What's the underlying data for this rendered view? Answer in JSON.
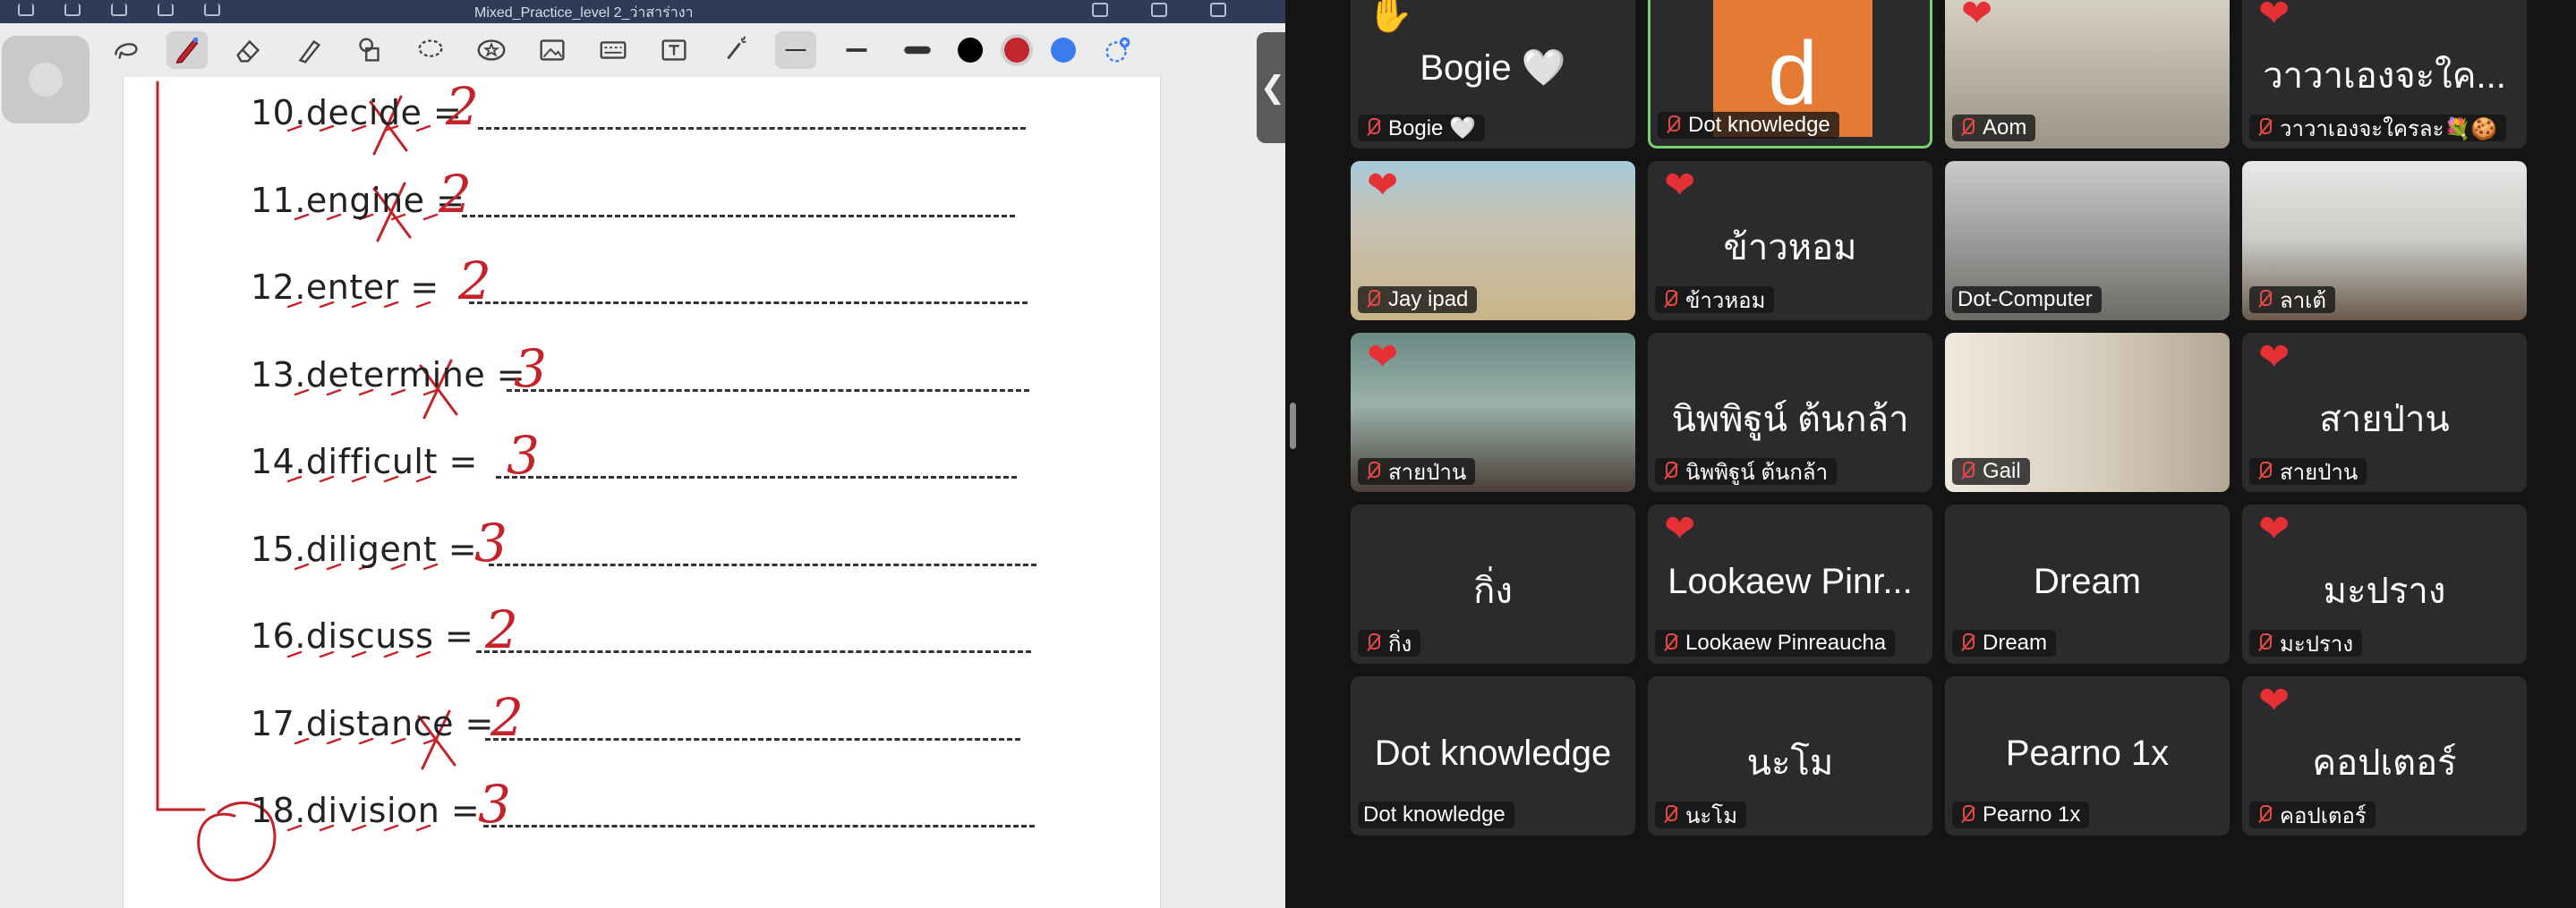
{
  "note_app": {
    "document_title": "Mixed_Practice_level 2_ว่าสาร่างา",
    "collapse_glyph": "❮",
    "tools": [
      {
        "name": "lasso-icon",
        "selected": false
      },
      {
        "name": "pen-icon",
        "selected": true
      },
      {
        "name": "eraser-icon",
        "selected": false
      },
      {
        "name": "highlighter-icon",
        "selected": false
      },
      {
        "name": "shapes-icon",
        "selected": false
      },
      {
        "name": "lasso-select-icon",
        "selected": false
      },
      {
        "name": "sticker-icon",
        "selected": false
      },
      {
        "name": "image-icon",
        "selected": false
      },
      {
        "name": "keyboard-icon",
        "selected": false
      },
      {
        "name": "text-box-icon",
        "selected": false
      },
      {
        "name": "laser-pointer-icon",
        "selected": false
      },
      {
        "name": "thin-line-icon",
        "selected": true
      },
      {
        "name": "medium-line-icon",
        "selected": false
      },
      {
        "name": "thick-line-icon",
        "selected": false
      }
    ],
    "colors": [
      "#000000",
      "#c1272d",
      "#3b7bf0"
    ],
    "selected_color": "#c1272d",
    "exercises": [
      {
        "label": "10.decide =",
        "mark": "2"
      },
      {
        "label": "11.engine =",
        "mark": "2"
      },
      {
        "label": "12.enter =",
        "mark": "2"
      },
      {
        "label": "13.determine =",
        "mark": "3"
      },
      {
        "label": "14.difficult =",
        "mark": "3"
      },
      {
        "label": "15.diligent =",
        "mark": "3"
      },
      {
        "label": "16.discuss =",
        "mark": "2"
      },
      {
        "label": "17.distance =",
        "mark": "2"
      },
      {
        "label": "18.division =",
        "mark": "3"
      }
    ]
  },
  "gallery": {
    "accent_active": "#72d46c",
    "reaction_heart_color": "#e53136",
    "tiles": [
      {
        "display": "Bogie 🤍",
        "label": "Bogie 🤍",
        "muted": true,
        "reaction": "✋",
        "kind": "name"
      },
      {
        "display": "d",
        "label": "Dot knowledge",
        "muted": true,
        "reaction": "",
        "kind": "avatar",
        "active": true
      },
      {
        "display": "",
        "label": "Aom",
        "muted": true,
        "reaction": "❤",
        "kind": "video"
      },
      {
        "display": "วาวาเองจะใค...",
        "label": "วาวาเองจะใครละ💐🍪",
        "muted": true,
        "reaction": "❤",
        "kind": "name"
      },
      {
        "display": "",
        "label": "Jay ipad",
        "muted": true,
        "reaction": "❤",
        "kind": "video"
      },
      {
        "display": "ข้าวหอม",
        "label": "ข้าวหอม",
        "muted": true,
        "reaction": "❤",
        "kind": "name"
      },
      {
        "display": "",
        "label": "Dot-Computer",
        "muted": false,
        "reaction": "",
        "kind": "video"
      },
      {
        "display": "",
        "label": "ลาเต้",
        "muted": true,
        "reaction": "",
        "kind": "video"
      },
      {
        "display": "",
        "label": "สายป่าน",
        "muted": true,
        "reaction": "❤",
        "kind": "video"
      },
      {
        "display": "นิพพิฐูน์ ต้นกล้า",
        "label": "นิพพิฐูน์ ต้นกล้า",
        "muted": true,
        "reaction": "",
        "kind": "name"
      },
      {
        "display": "",
        "label": "Gail",
        "muted": true,
        "reaction": "",
        "kind": "video"
      },
      {
        "display": "สายป่าน",
        "label": "สายป่าน",
        "muted": true,
        "reaction": "❤",
        "kind": "name"
      },
      {
        "display": "กิ่ง",
        "label": "กิ่ง",
        "muted": true,
        "reaction": "",
        "kind": "name"
      },
      {
        "display": "Lookaew Pinr...",
        "label": "Lookaew Pinreaucha",
        "muted": true,
        "reaction": "❤",
        "kind": "name"
      },
      {
        "display": "Dream",
        "label": "Dream",
        "muted": true,
        "reaction": "",
        "kind": "name"
      },
      {
        "display": "มะปราง",
        "label": "มะปราง",
        "muted": true,
        "reaction": "❤",
        "kind": "name"
      },
      {
        "display": "Dot knowledge",
        "label": "Dot knowledge",
        "muted": false,
        "reaction": "",
        "kind": "name"
      },
      {
        "display": "นะโม",
        "label": "นะโม",
        "muted": true,
        "reaction": "",
        "kind": "name"
      },
      {
        "display": "Pearno 1x",
        "label": "Pearno 1x",
        "muted": true,
        "reaction": "",
        "kind": "name"
      },
      {
        "display": "คอปเตอร์",
        "label": "คอปเตอร์",
        "muted": true,
        "reaction": "❤",
        "kind": "name"
      }
    ]
  }
}
